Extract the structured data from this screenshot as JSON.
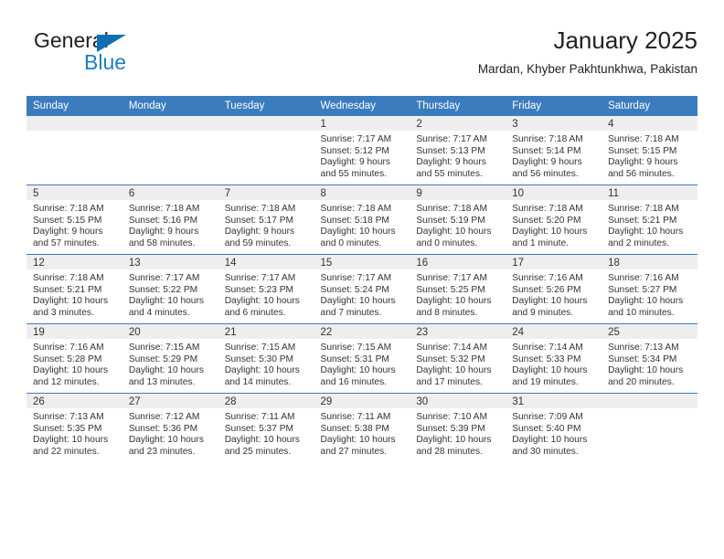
{
  "brand": {
    "name_part1": "General",
    "name_part2": "Blue",
    "logo_icon": "triangle-mark",
    "accent_color": "#1b7ec4"
  },
  "header": {
    "title": "January 2025",
    "subtitle": "Mardan, Khyber Pakhtunkhwa, Pakistan"
  },
  "theme": {
    "header_blue": "#3a7cbe",
    "band_gray": "#eeeeee",
    "text": "#333333"
  },
  "weekdays": [
    "Sunday",
    "Monday",
    "Tuesday",
    "Wednesday",
    "Thursday",
    "Friday",
    "Saturday"
  ],
  "labels": {
    "sunrise": "Sunrise:",
    "sunset": "Sunset:",
    "daylight": "Daylight:"
  },
  "weeks": [
    [
      {
        "day": "",
        "blank": true
      },
      {
        "day": "",
        "blank": true
      },
      {
        "day": "",
        "blank": true
      },
      {
        "day": "1",
        "sunrise": "Sunrise: 7:17 AM",
        "sunset": "Sunset: 5:12 PM",
        "daylight": "Daylight: 9 hours and 55 minutes."
      },
      {
        "day": "2",
        "sunrise": "Sunrise: 7:17 AM",
        "sunset": "Sunset: 5:13 PM",
        "daylight": "Daylight: 9 hours and 55 minutes."
      },
      {
        "day": "3",
        "sunrise": "Sunrise: 7:18 AM",
        "sunset": "Sunset: 5:14 PM",
        "daylight": "Daylight: 9 hours and 56 minutes."
      },
      {
        "day": "4",
        "sunrise": "Sunrise: 7:18 AM",
        "sunset": "Sunset: 5:15 PM",
        "daylight": "Daylight: 9 hours and 56 minutes."
      }
    ],
    [
      {
        "day": "5",
        "sunrise": "Sunrise: 7:18 AM",
        "sunset": "Sunset: 5:15 PM",
        "daylight": "Daylight: 9 hours and 57 minutes."
      },
      {
        "day": "6",
        "sunrise": "Sunrise: 7:18 AM",
        "sunset": "Sunset: 5:16 PM",
        "daylight": "Daylight: 9 hours and 58 minutes."
      },
      {
        "day": "7",
        "sunrise": "Sunrise: 7:18 AM",
        "sunset": "Sunset: 5:17 PM",
        "daylight": "Daylight: 9 hours and 59 minutes."
      },
      {
        "day": "8",
        "sunrise": "Sunrise: 7:18 AM",
        "sunset": "Sunset: 5:18 PM",
        "daylight": "Daylight: 10 hours and 0 minutes."
      },
      {
        "day": "9",
        "sunrise": "Sunrise: 7:18 AM",
        "sunset": "Sunset: 5:19 PM",
        "daylight": "Daylight: 10 hours and 0 minutes."
      },
      {
        "day": "10",
        "sunrise": "Sunrise: 7:18 AM",
        "sunset": "Sunset: 5:20 PM",
        "daylight": "Daylight: 10 hours and 1 minute."
      },
      {
        "day": "11",
        "sunrise": "Sunrise: 7:18 AM",
        "sunset": "Sunset: 5:21 PM",
        "daylight": "Daylight: 10 hours and 2 minutes."
      }
    ],
    [
      {
        "day": "12",
        "sunrise": "Sunrise: 7:18 AM",
        "sunset": "Sunset: 5:21 PM",
        "daylight": "Daylight: 10 hours and 3 minutes."
      },
      {
        "day": "13",
        "sunrise": "Sunrise: 7:17 AM",
        "sunset": "Sunset: 5:22 PM",
        "daylight": "Daylight: 10 hours and 4 minutes."
      },
      {
        "day": "14",
        "sunrise": "Sunrise: 7:17 AM",
        "sunset": "Sunset: 5:23 PM",
        "daylight": "Daylight: 10 hours and 6 minutes."
      },
      {
        "day": "15",
        "sunrise": "Sunrise: 7:17 AM",
        "sunset": "Sunset: 5:24 PM",
        "daylight": "Daylight: 10 hours and 7 minutes."
      },
      {
        "day": "16",
        "sunrise": "Sunrise: 7:17 AM",
        "sunset": "Sunset: 5:25 PM",
        "daylight": "Daylight: 10 hours and 8 minutes."
      },
      {
        "day": "17",
        "sunrise": "Sunrise: 7:16 AM",
        "sunset": "Sunset: 5:26 PM",
        "daylight": "Daylight: 10 hours and 9 minutes."
      },
      {
        "day": "18",
        "sunrise": "Sunrise: 7:16 AM",
        "sunset": "Sunset: 5:27 PM",
        "daylight": "Daylight: 10 hours and 10 minutes."
      }
    ],
    [
      {
        "day": "19",
        "sunrise": "Sunrise: 7:16 AM",
        "sunset": "Sunset: 5:28 PM",
        "daylight": "Daylight: 10 hours and 12 minutes."
      },
      {
        "day": "20",
        "sunrise": "Sunrise: 7:15 AM",
        "sunset": "Sunset: 5:29 PM",
        "daylight": "Daylight: 10 hours and 13 minutes."
      },
      {
        "day": "21",
        "sunrise": "Sunrise: 7:15 AM",
        "sunset": "Sunset: 5:30 PM",
        "daylight": "Daylight: 10 hours and 14 minutes."
      },
      {
        "day": "22",
        "sunrise": "Sunrise: 7:15 AM",
        "sunset": "Sunset: 5:31 PM",
        "daylight": "Daylight: 10 hours and 16 minutes."
      },
      {
        "day": "23",
        "sunrise": "Sunrise: 7:14 AM",
        "sunset": "Sunset: 5:32 PM",
        "daylight": "Daylight: 10 hours and 17 minutes."
      },
      {
        "day": "24",
        "sunrise": "Sunrise: 7:14 AM",
        "sunset": "Sunset: 5:33 PM",
        "daylight": "Daylight: 10 hours and 19 minutes."
      },
      {
        "day": "25",
        "sunrise": "Sunrise: 7:13 AM",
        "sunset": "Sunset: 5:34 PM",
        "daylight": "Daylight: 10 hours and 20 minutes."
      }
    ],
    [
      {
        "day": "26",
        "sunrise": "Sunrise: 7:13 AM",
        "sunset": "Sunset: 5:35 PM",
        "daylight": "Daylight: 10 hours and 22 minutes."
      },
      {
        "day": "27",
        "sunrise": "Sunrise: 7:12 AM",
        "sunset": "Sunset: 5:36 PM",
        "daylight": "Daylight: 10 hours and 23 minutes."
      },
      {
        "day": "28",
        "sunrise": "Sunrise: 7:11 AM",
        "sunset": "Sunset: 5:37 PM",
        "daylight": "Daylight: 10 hours and 25 minutes."
      },
      {
        "day": "29",
        "sunrise": "Sunrise: 7:11 AM",
        "sunset": "Sunset: 5:38 PM",
        "daylight": "Daylight: 10 hours and 27 minutes."
      },
      {
        "day": "30",
        "sunrise": "Sunrise: 7:10 AM",
        "sunset": "Sunset: 5:39 PM",
        "daylight": "Daylight: 10 hours and 28 minutes."
      },
      {
        "day": "31",
        "sunrise": "Sunrise: 7:09 AM",
        "sunset": "Sunset: 5:40 PM",
        "daylight": "Daylight: 10 hours and 30 minutes."
      },
      {
        "day": "",
        "blank": true
      }
    ]
  ]
}
